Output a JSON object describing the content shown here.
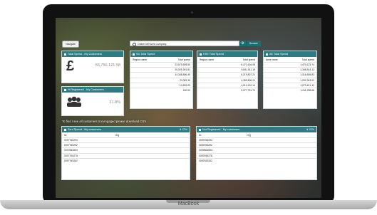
{
  "brand": "MacBook",
  "toolbar": {
    "nav_label": "Navigate",
    "search_value": "Online Services Company",
    "browse_label": "Browse"
  },
  "total_spend": {
    "title": "Total Spend - My Customers",
    "value": "55,756,121.58"
  },
  "registered": {
    "title": "% Registered - My Customers",
    "value": "21.8%"
  },
  "sd_spend": {
    "title": "SD Total Spend",
    "columns": [
      "Region name",
      "Total spend"
    ],
    "rows": [
      [
        "",
        "23,579,605.60"
      ],
      [
        "",
        "20,029,391.81"
      ],
      [
        "",
        "14,348,806.49"
      ],
      [
        "",
        "23,083.15"
      ],
      [
        "",
        "10,833.03"
      ],
      [
        "",
        "200.00"
      ]
    ]
  },
  "hse_spend": {
    "title": "HSE Total Spend",
    "columns": [
      "Region name",
      "Total spend"
    ],
    "rows": [
      [
        "",
        "6,471,604.08"
      ],
      [
        "",
        "5,841,511.15"
      ],
      [
        "",
        "5,219,807.21"
      ],
      [
        "",
        "4,389,806.24"
      ],
      [
        "",
        "4,013,192.14"
      ],
      [
        "",
        "3,377,751.72"
      ]
    ]
  },
  "ae_spend": {
    "title": "AE Total Spend",
    "columns": [
      "Area name",
      "Total spend"
    ],
    "rows": [
      [
        "",
        "1,470,123.74"
      ],
      [
        "",
        "1,348,514.12"
      ],
      [
        "",
        "1,316,605.83"
      ],
      [
        "",
        "1,252,343.02"
      ],
      [
        "",
        "1,073,421.12"
      ],
      [
        "",
        "1,011,298.66"
      ]
    ]
  },
  "notice": "To find / see all customers not engaged please download CSV",
  "zero_spend": {
    "title": "Zero Spend - My customers",
    "csv": "CSV",
    "columns": [
      "ID",
      "Org"
    ],
    "rows": [
      [
        "0007765294",
        ""
      ],
      [
        "0007765292",
        ""
      ],
      [
        "0007664693",
        ""
      ],
      [
        "0007765278",
        ""
      ],
      [
        "0007765262",
        ""
      ]
    ]
  },
  "not_registered": {
    "title": "Not Registered - My customers",
    "csv": "CSV",
    "columns": [
      "ID",
      "Org"
    ],
    "rows": [
      [
        "0009765294",
        ""
      ],
      [
        "0009765292",
        ""
      ],
      [
        "0009664693",
        ""
      ],
      [
        "0009765278",
        ""
      ],
      [
        "0009765262",
        ""
      ]
    ]
  }
}
